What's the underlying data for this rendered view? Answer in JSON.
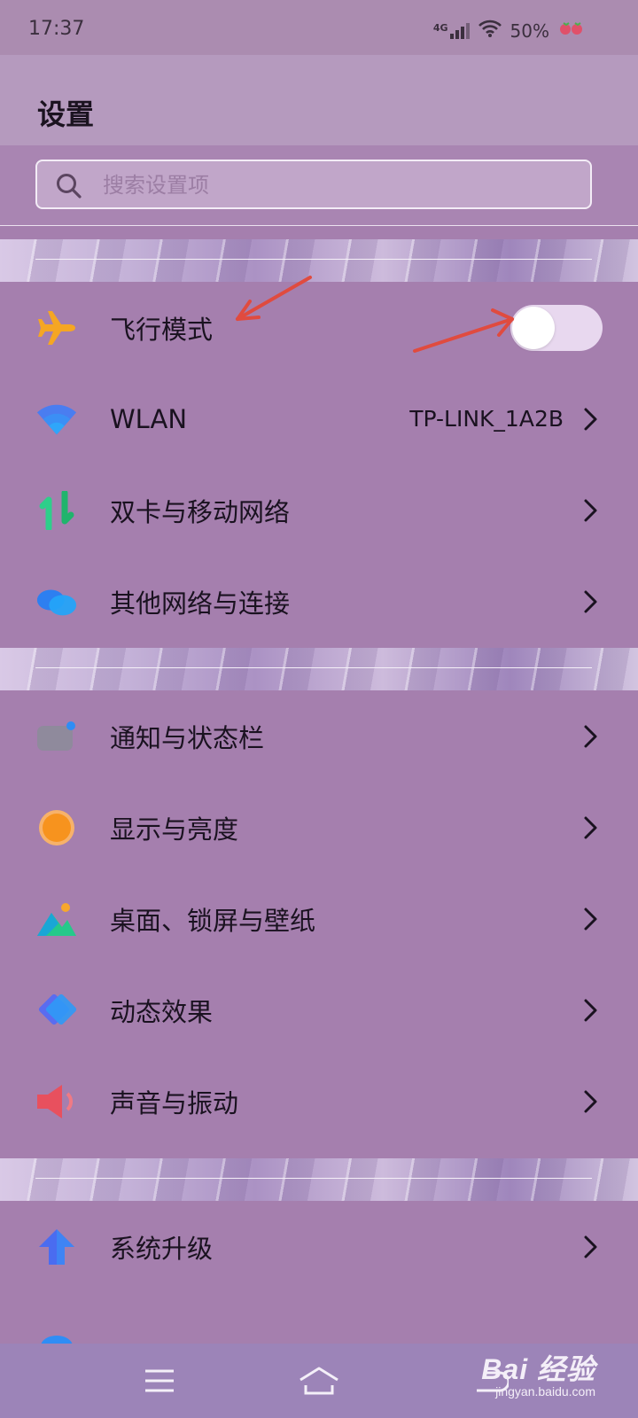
{
  "status_bar": {
    "time": "17:37",
    "network": "4G",
    "battery": "50%"
  },
  "header": {
    "title": "设置"
  },
  "search": {
    "placeholder": "搜索设置项"
  },
  "groups": [
    {
      "items": [
        {
          "icon": "airplane-icon",
          "label": "飞行模式",
          "control": "toggle",
          "toggle_on": false
        },
        {
          "icon": "wifi-icon",
          "label": "WLAN",
          "value": "TP-LINK_1A2B",
          "control": "chevron"
        },
        {
          "icon": "dual-sim-icon",
          "label": "双卡与移动网络",
          "control": "chevron"
        },
        {
          "icon": "other-connections-icon",
          "label": "其他网络与连接",
          "control": "chevron"
        }
      ]
    },
    {
      "items": [
        {
          "icon": "notification-icon",
          "label": "通知与状态栏",
          "control": "chevron"
        },
        {
          "icon": "display-icon",
          "label": "显示与亮度",
          "control": "chevron"
        },
        {
          "icon": "wallpaper-icon",
          "label": "桌面、锁屏与壁纸",
          "control": "chevron"
        },
        {
          "icon": "animation-icon",
          "label": "动态效果",
          "control": "chevron"
        },
        {
          "icon": "sound-icon",
          "label": "声音与振动",
          "control": "chevron"
        }
      ]
    },
    {
      "items": [
        {
          "icon": "system-update-icon",
          "label": "系统升级",
          "control": "chevron"
        }
      ]
    }
  ],
  "watermark": {
    "main": "Bai 经验",
    "sub": "jingyan.baidu.com"
  },
  "colors": {
    "annotation_arrow": "#e04b3f",
    "airplane": "#f5a623",
    "toggle_track": "#e8d8ef"
  }
}
